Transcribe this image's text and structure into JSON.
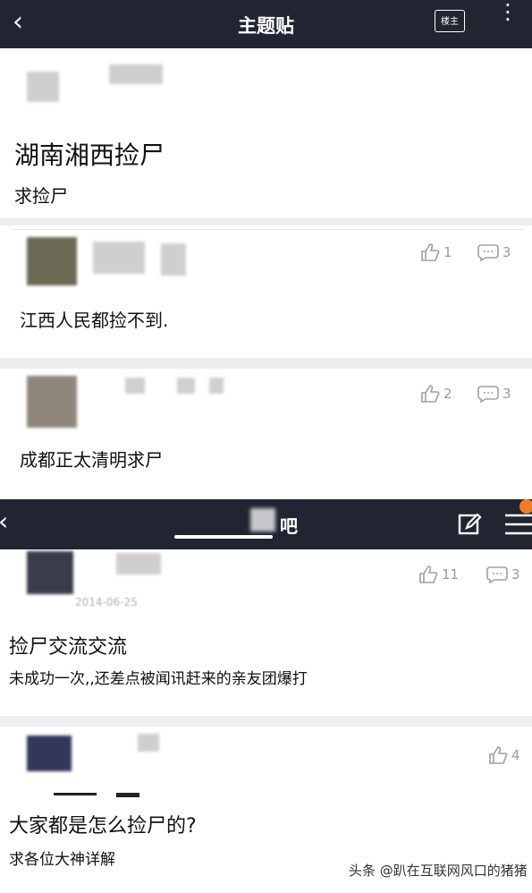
{
  "header": {
    "back_glyph": "‹",
    "title": "主题贴",
    "owner_button": "楼主",
    "more_glyph": "⋮"
  },
  "post": {
    "title": "湖南湘西捡尸",
    "body": "求捡尸"
  },
  "replies": [
    {
      "text": "江西人民都捡不到.",
      "likes": "1",
      "comments": "3"
    },
    {
      "text": "成都正太清明求尸",
      "likes": "2",
      "comments": "3"
    }
  ],
  "forum_bar": {
    "back_glyph": "‹",
    "name": "吧"
  },
  "threads": [
    {
      "date": "2014-06-25",
      "title": "捡尸交流交流",
      "subtitle": "未成功一次,,还差点被闻讯赶来的亲友团爆打",
      "likes": "11",
      "comments": "3"
    },
    {
      "title": "大家都是怎么捡尸的?",
      "subtitle": "求各位大神详解",
      "likes": "4"
    }
  ],
  "watermark": "头条 @趴在互联网风口的猪猪",
  "icons": [
    "back-icon",
    "owner-icon",
    "more-icon",
    "thumbs-up-icon",
    "comment-icon",
    "edit-icon",
    "menu-icon"
  ]
}
